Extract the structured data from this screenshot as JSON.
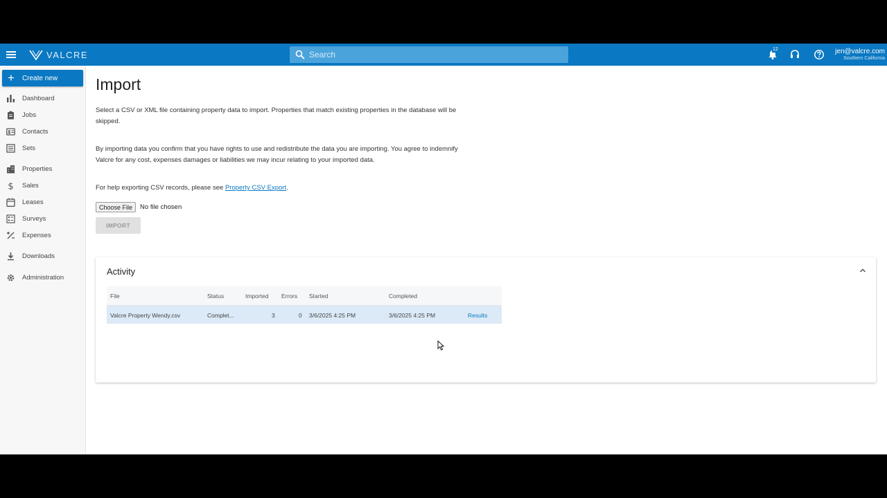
{
  "header": {
    "logo_text": "VALCRE",
    "search_placeholder": "Search",
    "notification_count": "12",
    "user_email": "jen@valcre.com",
    "user_region": "Southern California",
    "accent_color": "#0a78c2"
  },
  "sidebar": {
    "create_label": "Create new",
    "items": [
      {
        "label": "Dashboard",
        "icon": "bar-chart-icon"
      },
      {
        "label": "Jobs",
        "icon": "clipboard-icon"
      },
      {
        "label": "Contacts",
        "icon": "contact-card-icon"
      },
      {
        "label": "Sets",
        "icon": "list-icon"
      },
      {
        "label": "Properties",
        "icon": "building-icon"
      },
      {
        "label": "Sales",
        "icon": "dollar-icon"
      },
      {
        "label": "Leases",
        "icon": "calendar-icon"
      },
      {
        "label": "Surveys",
        "icon": "survey-icon"
      },
      {
        "label": "Expenses",
        "icon": "percent-icon"
      },
      {
        "label": "Downloads",
        "icon": "download-icon"
      },
      {
        "label": "Administration",
        "icon": "gear-icon"
      }
    ]
  },
  "main": {
    "title": "Import",
    "intro": "Select a CSV or XML file containing property data to import. Properties that match existing properties in the database will be skipped.",
    "terms": "By importing data you confirm that you have rights to use and redistribute the data you are importing. You agree to indemnify Valcre for any cost, expenses damages or liabilities we may incur relating to your imported data.",
    "help_prefix": "For help exporting CSV records, please see ",
    "help_link": "Property CSV Export",
    "help_suffix": ".",
    "choose_file_label": "Choose File",
    "no_file_label": "No file chosen",
    "import_label": "IMPORT"
  },
  "activity": {
    "title": "Activity",
    "columns": [
      "File",
      "Status",
      "Imported",
      "Errors",
      "Started",
      "Completed"
    ],
    "rows": [
      {
        "file": "Valcre Property Wendy.csv",
        "status": "Complet...",
        "imported": "3",
        "errors": "0",
        "started": "3/6/2025 4:25 PM",
        "completed": "3/6/2025 4:25 PM",
        "action": "Results"
      }
    ]
  }
}
